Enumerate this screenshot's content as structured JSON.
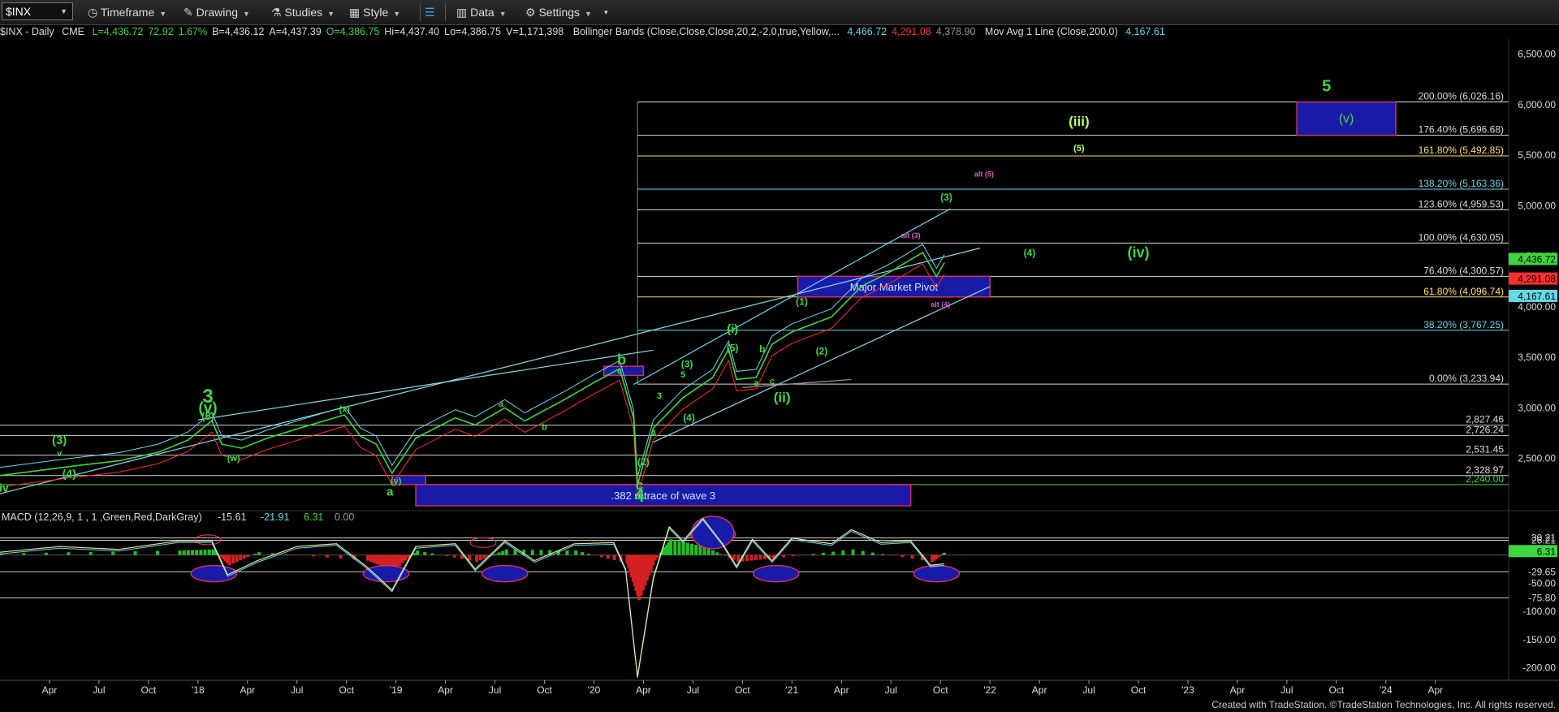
{
  "toolbar": {
    "symbol": "$INX",
    "timeframe": "Timeframe",
    "drawing": "Drawing",
    "studies": "Studies",
    "style": "Style",
    "data": "Data",
    "settings": "Settings"
  },
  "infobar": {
    "symbol": "$INX - Daily",
    "exchange": "CME",
    "quote": [
      {
        "text": "L=4,436.72",
        "color": "#3fd63f"
      },
      {
        "text": "72.92",
        "color": "#3fd63f"
      },
      {
        "text": "1.67%",
        "color": "#3fd63f"
      },
      {
        "text": "B=4,436.12",
        "color": "#dddddd"
      },
      {
        "text": "A=4,437.39",
        "color": "#dddddd"
      },
      {
        "text": "O=4,386.75",
        "color": "#3fd63f"
      },
      {
        "text": "Hi=4,437.40",
        "color": "#dddddd"
      },
      {
        "text": "Lo=4,386.75",
        "color": "#dddddd"
      },
      {
        "text": "V=1,171,398",
        "color": "#dddddd"
      }
    ],
    "bollinger_label": "Bollinger Bands (Close,Close,Close,20,2,-2,0,true,Yellow,...",
    "bollinger_values": [
      {
        "text": "4,466.72",
        "color": "#66d9e8"
      },
      {
        "text": "4,291.08",
        "color": "#ff3030"
      },
      {
        "text": "4,378.90",
        "color": "#999999"
      }
    ],
    "ma_label": "Mov Avg 1 Line (Close,200,0)",
    "ma_value": {
      "text": "4,167.61",
      "color": "#66d9e8"
    }
  },
  "macd": {
    "label": "MACD (12,26,9, 1 , 1 ,Green,Red,DarkGray)",
    "values": [
      {
        "text": "-15.61",
        "color": "#dddddd"
      },
      {
        "text": "-21.91",
        "color": "#66d9e8"
      },
      {
        "text": "6.31",
        "color": "#3fd63f"
      },
      {
        "text": "0.00",
        "color": "#999999"
      }
    ]
  },
  "footer": "Created with TradeStation. ©TradeStation Technologies, Inc. All rights reserved.",
  "chart_data": {
    "type": "line",
    "series_name": "$INX - Daily",
    "x_ticks": [
      "Apr",
      "Jul",
      "Oct",
      "'18",
      "Apr",
      "Jul",
      "Oct",
      "'19",
      "Apr",
      "Jul",
      "Oct",
      "'20",
      "Apr",
      "Jul",
      "Oct",
      "'21",
      "Apr",
      "Jul",
      "Oct",
      "'22",
      "Apr",
      "Jul",
      "Oct",
      "'23",
      "Apr",
      "Jul",
      "Oct",
      "'24",
      "Apr"
    ],
    "y_ticks": [
      2500,
      3000,
      3500,
      4000,
      4500,
      5000,
      5500,
      6000,
      6500
    ],
    "ylim": [
      2030,
      6650
    ],
    "price_path": [
      [
        2017.0,
        2330
      ],
      [
        2017.2,
        2380
      ],
      [
        2017.4,
        2430
      ],
      [
        2017.6,
        2475
      ],
      [
        2017.8,
        2560
      ],
      [
        2017.95,
        2680
      ],
      [
        2018.07,
        2872
      ],
      [
        2018.12,
        2640
      ],
      [
        2018.22,
        2600
      ],
      [
        2018.35,
        2700
      ],
      [
        2018.55,
        2820
      ],
      [
        2018.74,
        2930
      ],
      [
        2018.82,
        2720
      ],
      [
        2018.9,
        2640
      ],
      [
        2018.98,
        2351
      ],
      [
        2019.1,
        2700
      ],
      [
        2019.3,
        2900
      ],
      [
        2019.4,
        2830
      ],
      [
        2019.55,
        3000
      ],
      [
        2019.65,
        2870
      ],
      [
        2019.85,
        3080
      ],
      [
        2020.0,
        3250
      ],
      [
        2020.13,
        3386
      ],
      [
        2020.2,
        2900
      ],
      [
        2020.22,
        2237
      ],
      [
        2020.3,
        2800
      ],
      [
        2020.45,
        3100
      ],
      [
        2020.6,
        3300
      ],
      [
        2020.68,
        3580
      ],
      [
        2020.72,
        3280
      ],
      [
        2020.82,
        3300
      ],
      [
        2020.9,
        3630
      ],
      [
        2021.0,
        3750
      ],
      [
        2021.2,
        3900
      ],
      [
        2021.35,
        4200
      ],
      [
        2021.5,
        4350
      ],
      [
        2021.66,
        4537
      ],
      [
        2021.73,
        4300
      ],
      [
        2021.77,
        4436.72
      ]
    ],
    "horizontal_levels": [
      {
        "value": 2827.46,
        "label": "2,827.46"
      },
      {
        "value": 2726.24,
        "label": "2,726.24"
      },
      {
        "value": 2531.45,
        "label": "2,531.45"
      },
      {
        "value": 2328.97,
        "label": "2,328.97"
      },
      {
        "value": 2240.0,
        "label": "2,240.00"
      }
    ],
    "fib_levels": [
      {
        "value": 6026.16,
        "label": "200.00% (6,026.16)",
        "color": "#dddddd"
      },
      {
        "value": 5696.68,
        "label": "176.40% (5,696.68)",
        "color": "#dddddd"
      },
      {
        "value": 5492.85,
        "label": "161.80% (5,492.85)",
        "color": "#ffe066"
      },
      {
        "value": 5163.36,
        "label": "138.20% (5,163.36)",
        "color": "#66d9e8"
      },
      {
        "value": 4959.53,
        "label": "123.60% (4,959.53)",
        "color": "#dddddd"
      },
      {
        "value": 4630.05,
        "label": "100.00% (4,630.05)",
        "color": "#dddddd"
      },
      {
        "value": 4300.57,
        "label": "76.40% (4,300.57)",
        "color": "#dddddd"
      },
      {
        "value": 4096.74,
        "label": "61.80% (4,096.74)",
        "color": "#ffe066"
      },
      {
        "value": 3767.25,
        "label": "38.20% (3,767.25)",
        "color": "#66d9e8"
      },
      {
        "value": 3233.94,
        "label": "0.00% (3,233.94)",
        "color": "#dddddd"
      }
    ],
    "right_axis_tags": [
      {
        "text": "4,436.72",
        "color": "#3fd63f",
        "value": 4436.72
      },
      {
        "text": "4,291.08",
        "color": "#ff3030",
        "value": 4291.08
      },
      {
        "text": "4,167.61",
        "color": "#66d9e8",
        "value": 4167.61
      }
    ],
    "annotation_boxes": [
      {
        "label": "Major Market Pivot",
        "x": [
          2021.03,
          2022.0
        ],
        "y": [
          4096.74,
          4300.57
        ]
      },
      {
        "label": ".382 retrace of wave 3",
        "x": [
          2019.1,
          2021.6
        ],
        "y": [
          2030,
          2240
        ]
      },
      {
        "label": "",
        "x": [
          2018.98,
          2019.15
        ],
        "y": [
          2240,
          2330
        ]
      },
      {
        "label": "",
        "x": [
          2020.05,
          2020.25
        ],
        "y": [
          3320,
          3410
        ]
      },
      {
        "label": "(v)",
        "x": [
          2023.55,
          2024.05
        ],
        "y": [
          5696.68,
          6026.16
        ]
      }
    ],
    "wave_labels": [
      {
        "text": "5",
        "x": 2023.7,
        "y": 6130,
        "size": 20,
        "color": "#3fd63f"
      },
      {
        "text": "(iii)",
        "x": 2022.45,
        "y": 5790,
        "size": 17,
        "color": "#b3ff66"
      },
      {
        "text": "(5)",
        "x": 2022.45,
        "y": 5540,
        "size": 11,
        "color": "#b3ff66"
      },
      {
        "text": "alt (5)",
        "x": 2021.97,
        "y": 5290,
        "size": 9,
        "color": "#d060d0"
      },
      {
        "text": "(3)",
        "x": 2021.78,
        "y": 5050,
        "size": 12,
        "color": "#3fd63f"
      },
      {
        "text": "alt (3)",
        "x": 2021.6,
        "y": 4680,
        "size": 9,
        "color": "#d060d0"
      },
      {
        "text": "(4)",
        "x": 2022.2,
        "y": 4500,
        "size": 12,
        "color": "#3fd63f"
      },
      {
        "text": "(iv)",
        "x": 2022.75,
        "y": 4490,
        "size": 18,
        "color": "#3fd63f"
      },
      {
        "text": "alt (4)",
        "x": 2021.75,
        "y": 4000,
        "size": 9,
        "color": "#d060d0"
      },
      {
        "text": "(1)",
        "x": 2021.05,
        "y": 4020,
        "size": 12,
        "color": "#3fd63f"
      },
      {
        "text": "(2)",
        "x": 2021.15,
        "y": 3530,
        "size": 12,
        "color": "#3fd63f"
      },
      {
        "text": "(i)",
        "x": 2020.7,
        "y": 3740,
        "size": 15,
        "color": "#3fd63f"
      },
      {
        "text": "(5)",
        "x": 2020.7,
        "y": 3560,
        "size": 12,
        "color": "#3fd63f"
      },
      {
        "text": "b",
        "x": 2020.85,
        "y": 3550,
        "size": 12,
        "color": "#3fd63f"
      },
      {
        "text": "a",
        "x": 2020.82,
        "y": 3220,
        "size": 11,
        "color": "#3fd63f"
      },
      {
        "text": "c",
        "x": 2020.9,
        "y": 3235,
        "size": 11,
        "color": "#3fd63f"
      },
      {
        "text": "(ii)",
        "x": 2020.95,
        "y": 3060,
        "size": 17,
        "color": "#3fd63f"
      },
      {
        "text": "(3)",
        "x": 2020.47,
        "y": 3400,
        "size": 12,
        "color": "#3fd63f"
      },
      {
        "text": "5",
        "x": 2020.45,
        "y": 3300,
        "size": 11,
        "color": "#3fd63f"
      },
      {
        "text": "3",
        "x": 2020.33,
        "y": 3090,
        "size": 11,
        "color": "#3fd63f"
      },
      {
        "text": "(4)",
        "x": 2020.48,
        "y": 2870,
        "size": 12,
        "color": "#3fd63f"
      },
      {
        "text": "4",
        "x": 2020.3,
        "y": 2720,
        "size": 11,
        "color": "#3fd63f"
      },
      {
        "text": "(2)",
        "x": 2020.25,
        "y": 2430,
        "size": 12,
        "color": "#3fd63f"
      },
      {
        "text": "b",
        "x": 2020.14,
        "y": 3430,
        "size": 18,
        "color": "#3fd63f"
      },
      {
        "text": "c",
        "x": 2020.13,
        "y": 3335,
        "size": 11,
        "color": "#3fd63f"
      },
      {
        "text": "c",
        "x": 2020.23,
        "y": 2190,
        "size": 17,
        "color": "#3fd63f"
      },
      {
        "text": "4",
        "x": 2020.23,
        "y": 2070,
        "size": 22,
        "color": "#3fd63f"
      },
      {
        "text": "3",
        "x": 2018.05,
        "y": 3050,
        "size": 24,
        "color": "#3fd63f"
      },
      {
        "text": "(v)",
        "x": 2018.05,
        "y": 2950,
        "size": 19,
        "color": "#3fd63f"
      },
      {
        "text": "(5)",
        "x": 2018.05,
        "y": 2880,
        "size": 13,
        "color": "#3fd63f"
      },
      {
        "text": "(x)",
        "x": 2018.74,
        "y": 2960,
        "size": 11,
        "color": "#3fd63f"
      },
      {
        "text": "(w)",
        "x": 2018.18,
        "y": 2470,
        "size": 11,
        "color": "#3fd63f"
      },
      {
        "text": "(y)",
        "x": 2019.0,
        "y": 2245,
        "size": 11,
        "color": "#3fd63f"
      },
      {
        "text": "a",
        "x": 2018.97,
        "y": 2130,
        "size": 15,
        "color": "#3fd63f"
      },
      {
        "text": "a",
        "x": 2019.53,
        "y": 3010,
        "size": 11,
        "color": "#3fd63f"
      },
      {
        "text": "b",
        "x": 2019.75,
        "y": 2780,
        "size": 11,
        "color": "#3fd63f"
      },
      {
        "text": "(3)",
        "x": 2017.3,
        "y": 2640,
        "size": 15,
        "color": "#3fd63f"
      },
      {
        "text": "v",
        "x": 2017.3,
        "y": 2520,
        "size": 11,
        "color": "#3fd63f"
      },
      {
        "text": "(4)",
        "x": 2017.35,
        "y": 2310,
        "size": 14,
        "color": "#3fd63f"
      },
      {
        "text": "iv",
        "x": 2017.02,
        "y": 2170,
        "size": 14,
        "color": "#3fd63f"
      }
    ],
    "macd_axis": {
      "ticks": [
        {
          "label": "-50.00",
          "value": -50
        },
        {
          "label": "-100.00",
          "value": -100
        },
        {
          "label": "-150.00",
          "value": -150
        },
        {
          "label": "-200.00",
          "value": -200
        }
      ],
      "levels": [
        {
          "label": "30.21",
          "value": 30.21
        },
        {
          "label": "26.21",
          "value": 26.21
        },
        {
          "label": "-29.65",
          "value": -29.65
        },
        {
          "label": "-75.80",
          "value": -75.8
        }
      ],
      "tag": {
        "text": "6.31",
        "color": "#3fd63f",
        "value": 6.31
      },
      "ylim": [
        -222,
        70
      ]
    },
    "macd_path": [
      [
        2017.0,
        5
      ],
      [
        2017.3,
        15
      ],
      [
        2017.6,
        10
      ],
      [
        2017.9,
        25
      ],
      [
        2018.07,
        25
      ],
      [
        2018.15,
        -35
      ],
      [
        2018.3,
        -10
      ],
      [
        2018.5,
        15
      ],
      [
        2018.7,
        20
      ],
      [
        2018.85,
        -20
      ],
      [
        2018.98,
        -62
      ],
      [
        2019.1,
        15
      ],
      [
        2019.3,
        20
      ],
      [
        2019.4,
        -25
      ],
      [
        2019.55,
        25
      ],
      [
        2019.7,
        -10
      ],
      [
        2019.9,
        20
      ],
      [
        2020.1,
        22
      ],
      [
        2020.16,
        -25
      ],
      [
        2020.22,
        -215
      ],
      [
        2020.3,
        -40
      ],
      [
        2020.38,
        50
      ],
      [
        2020.45,
        25
      ],
      [
        2020.55,
        65
      ],
      [
        2020.65,
        20
      ],
      [
        2020.72,
        -20
      ],
      [
        2020.8,
        28
      ],
      [
        2020.9,
        -10
      ],
      [
        2021.0,
        30
      ],
      [
        2021.2,
        20
      ],
      [
        2021.3,
        45
      ],
      [
        2021.45,
        22
      ],
      [
        2021.6,
        25
      ],
      [
        2021.7,
        -18
      ],
      [
        2021.77,
        -15.61
      ]
    ],
    "macd_hist_path": [
      [
        2017.0,
        3
      ],
      [
        2017.9,
        8
      ],
      [
        2018.07,
        10
      ],
      [
        2018.15,
        -18
      ],
      [
        2018.3,
        5
      ],
      [
        2018.85,
        -10
      ],
      [
        2018.98,
        -28
      ],
      [
        2019.1,
        8
      ],
      [
        2019.4,
        -12
      ],
      [
        2019.55,
        10
      ],
      [
        2019.9,
        8
      ],
      [
        2020.16,
        -15
      ],
      [
        2020.22,
        -80
      ],
      [
        2020.3,
        -10
      ],
      [
        2020.38,
        28
      ],
      [
        2020.55,
        15
      ],
      [
        2020.72,
        -12
      ],
      [
        2020.9,
        -6
      ],
      [
        2021.3,
        10
      ],
      [
        2021.7,
        -12
      ],
      [
        2021.77,
        6.31
      ]
    ],
    "macd_ovals": [
      {
        "x": 2018.08,
        "y": -33
      },
      {
        "x": 2018.95,
        "y": -33
      },
      {
        "x": 2019.55,
        "y": -33
      },
      {
        "x": 2020.6,
        "y": 37
      },
      {
        "x": 2020.92,
        "y": -33
      },
      {
        "x": 2021.73,
        "y": -33
      }
    ],
    "macd_small_ovals": [
      {
        "x": 2018.05,
        "y": 27
      },
      {
        "x": 2019.44,
        "y": 22
      }
    ],
    "trendlines": [
      {
        "x": [
          2017.0,
          2021.95
        ],
        "y": [
          2150,
          4580
        ],
        "color": "#8fd8e8"
      },
      {
        "x": [
          2018.0,
          2020.3
        ],
        "y": [
          2880,
          3570
        ],
        "color": "#8fd8e8"
      },
      {
        "x": [
          2020.2,
          2021.8
        ],
        "y": [
          3230,
          4970
        ],
        "color": "#66d9e8"
      },
      {
        "x": [
          2020.3,
          2022.0
        ],
        "y": [
          2660,
          4200
        ],
        "color": "#8fd8e8"
      },
      {
        "x": [
          2020.75,
          2021.3
        ],
        "y": [
          3200,
          3280
        ],
        "color": "#999999"
      }
    ]
  }
}
